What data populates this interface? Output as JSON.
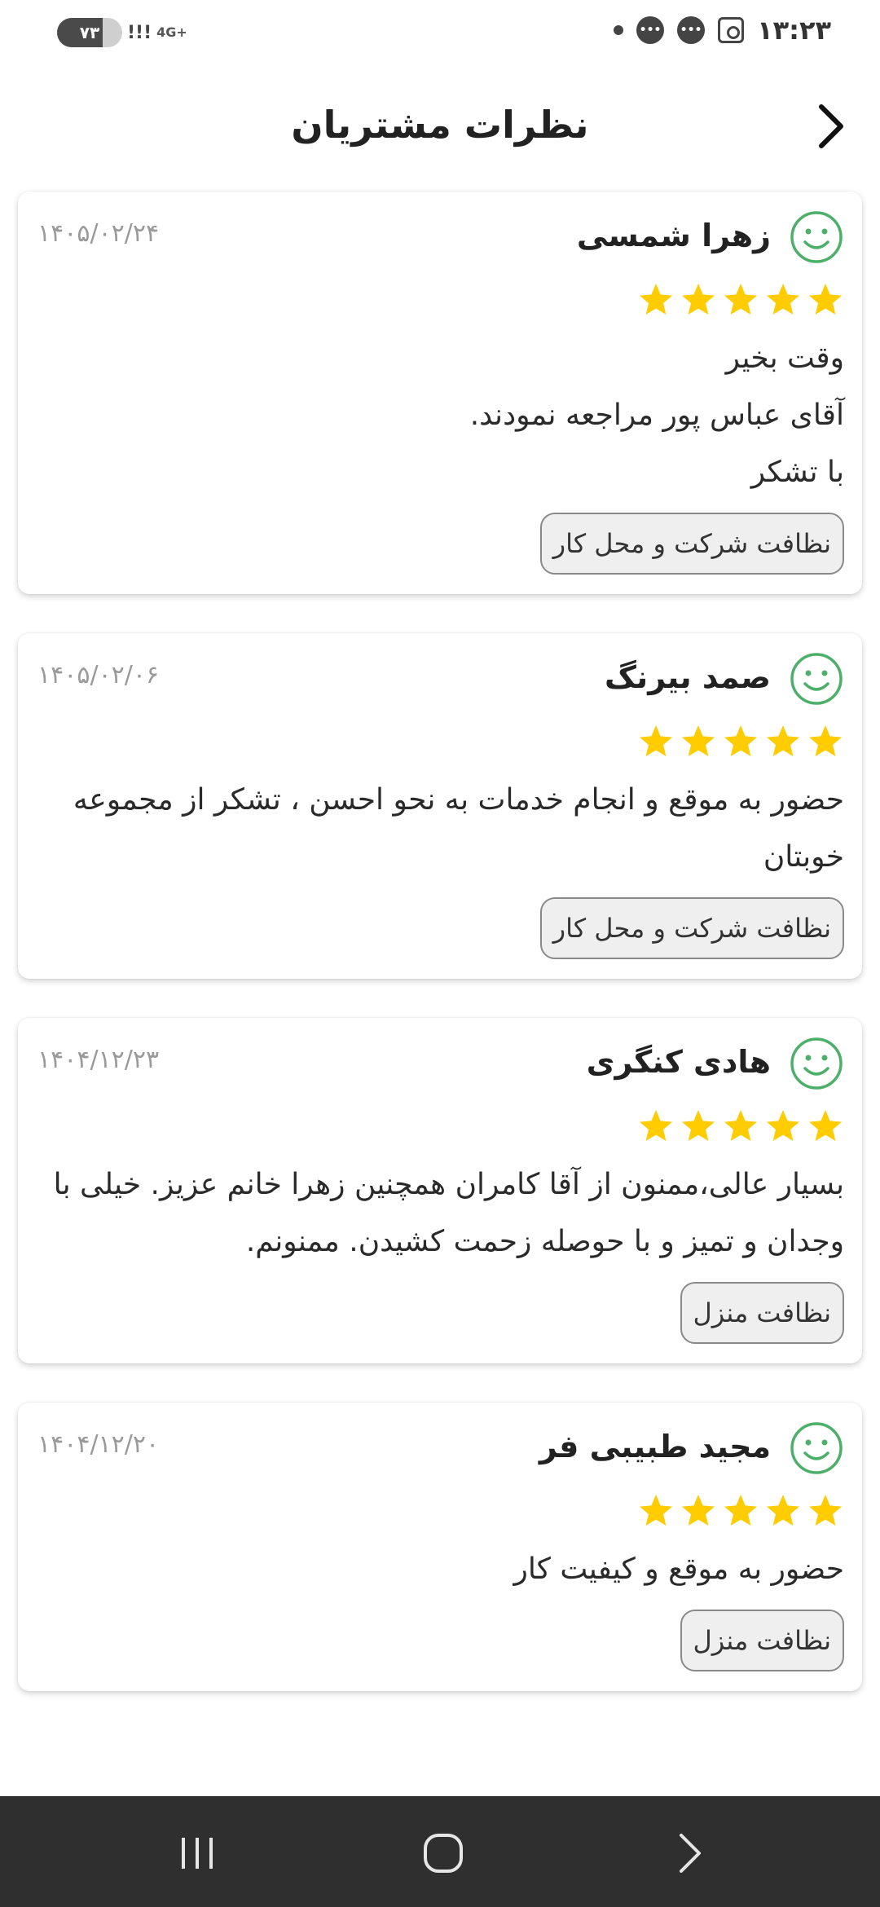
{
  "status_bar": {
    "time": "۱۳:۲۳",
    "battery": "۷۳",
    "network": "4G+",
    "icons": [
      "dot-icon",
      "chat-bubble-icon",
      "chat-bubble-icon",
      "screenshot-scan-icon"
    ]
  },
  "header": {
    "title": "نظرات مشتریان",
    "back_icon": "chevron-right-icon"
  },
  "reviews": [
    {
      "name": "زهرا شمسی",
      "date": "۱۴۰۵/۰۲/۲۴",
      "rating": 5,
      "text": "وقت بخیر\nآقای عباس پور مراجعه نمودند.\nبا تشکر",
      "tag": "نظافت شرکت و محل کار"
    },
    {
      "name": "صمد بیرنگ",
      "date": "۱۴۰۵/۰۲/۰۶",
      "rating": 5,
      "text": "حضور به موقع و انجام خدمات به نحو احسن ، تشکر از مجموعه خوبتان",
      "tag": "نظافت شرکت و محل کار"
    },
    {
      "name": "هادی کنگری",
      "date": "۱۴۰۴/۱۲/۲۳",
      "rating": 5,
      "text": "بسیار عالی،ممنون از آقا کامران همچنین زهرا خانم عزیز. خیلی با وجدان و تمیز و با حوصله زحمت کشیدن. ممنونم.",
      "tag": "نظافت منزل"
    },
    {
      "name": "مجید طبیبی فر",
      "date": "۱۴۰۴/۱۲/۲۰",
      "rating": 5,
      "text": "حضور به موقع و کیفیت کار",
      "tag": "نظافت منزل"
    }
  ],
  "colors": {
    "star": "#FFCC00",
    "avatar": "#4CAF6A",
    "navbar": "#2F2F2F"
  },
  "nav_bar": {
    "icons": [
      "recent-apps-icon",
      "home-icon",
      "back-icon"
    ]
  }
}
